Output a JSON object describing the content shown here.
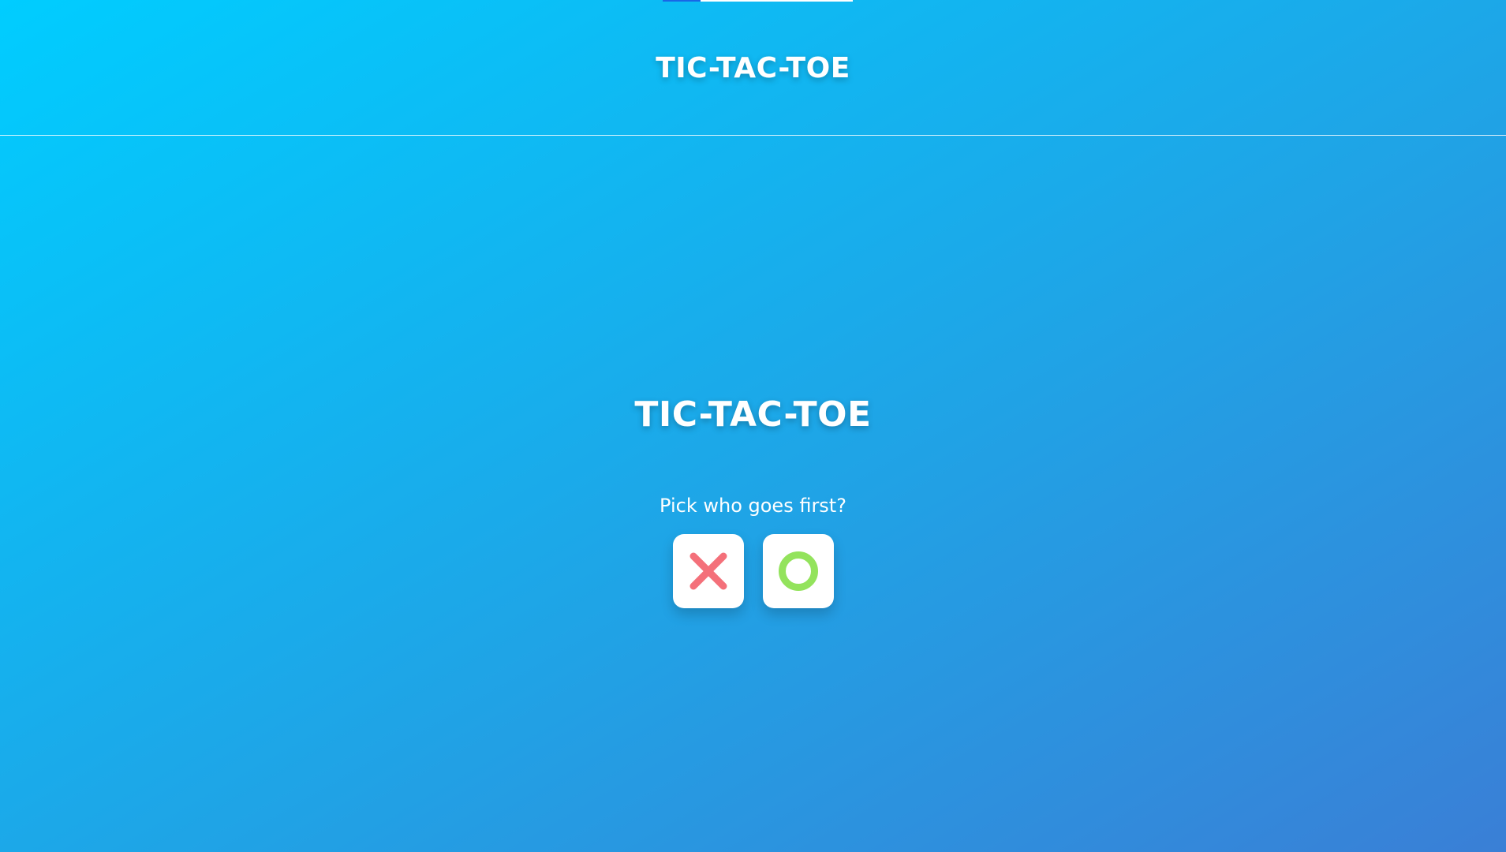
{
  "header": {
    "title": "TIC-TAC-TOE",
    "progress_fraction": 0.2
  },
  "main": {
    "title": "TIC-TAC-TOE",
    "prompt": "Pick who goes first?",
    "choices": [
      {
        "icon": "x-mark-icon",
        "color": "#f4707a"
      },
      {
        "icon": "o-mark-icon",
        "color": "#93e35c"
      }
    ]
  },
  "colors": {
    "background_start": "#00cdff",
    "background_end": "#3a7fd6",
    "progress_fill": "#1966e6",
    "tile": "#ffffff"
  }
}
